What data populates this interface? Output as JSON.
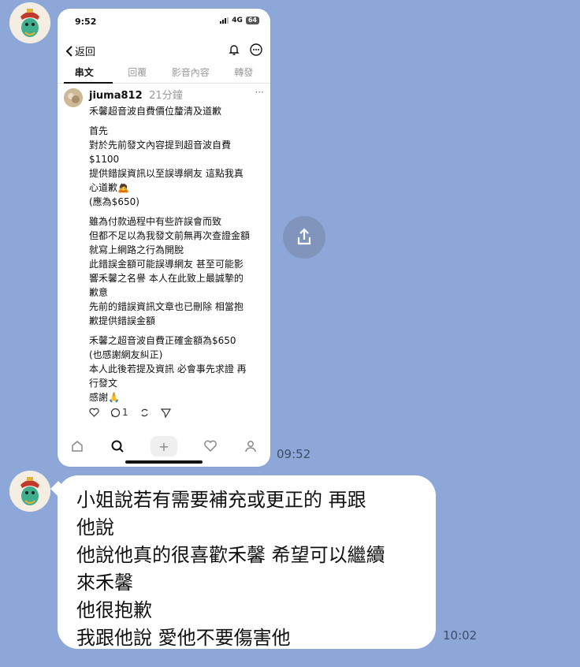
{
  "chat": {
    "time_1": "09:52",
    "time_2": "10:02",
    "message_text": "小姐說若有需要補充或更正的 再跟\n他說\n他說他真的很喜歡禾馨 希望可以繼續\n來禾馨\n他很抱歉\n我跟他說 愛他不要傷害他"
  },
  "screenshot": {
    "status_time": "9:52",
    "network": "4G",
    "battery": "64",
    "back_label": "返回",
    "tabs": [
      "串文",
      "回覆",
      "影音內容",
      "轉發"
    ],
    "post": {
      "username": "jiuma812",
      "time_ago": "21分鐘",
      "title": "禾馨超音波自費價位釐清及道歉",
      "para1": "首先\n對於先前發文內容提到超音波自費\n$1100\n提供錯誤資訊以至誤導網友 這點我真\n心道歉🙇\n(應為$650)",
      "para2": "雖為付款過程中有些許誤會而致\n但都不足以為我發文前無再次查證金額\n就寫上網路之行為開脫\n此錯誤金額可能誤導網友 甚至可能影\n響禾馨之名譽 本人在此致上最誠摯的\n歉意\n先前的錯誤資訊文章也已刪除 相當抱\n歉提供錯誤金額",
      "para3": "禾馨之超音波自費正確金額為$650\n(也感謝網友糾正)\n本人此後若提及資訊 必會事先求證 再\n行發文\n感謝🙏",
      "reply_count": "1"
    }
  },
  "icons": {
    "back": "chevron-left-icon",
    "bell": "bell-icon",
    "more": "more-icon",
    "share": "share-icon"
  }
}
